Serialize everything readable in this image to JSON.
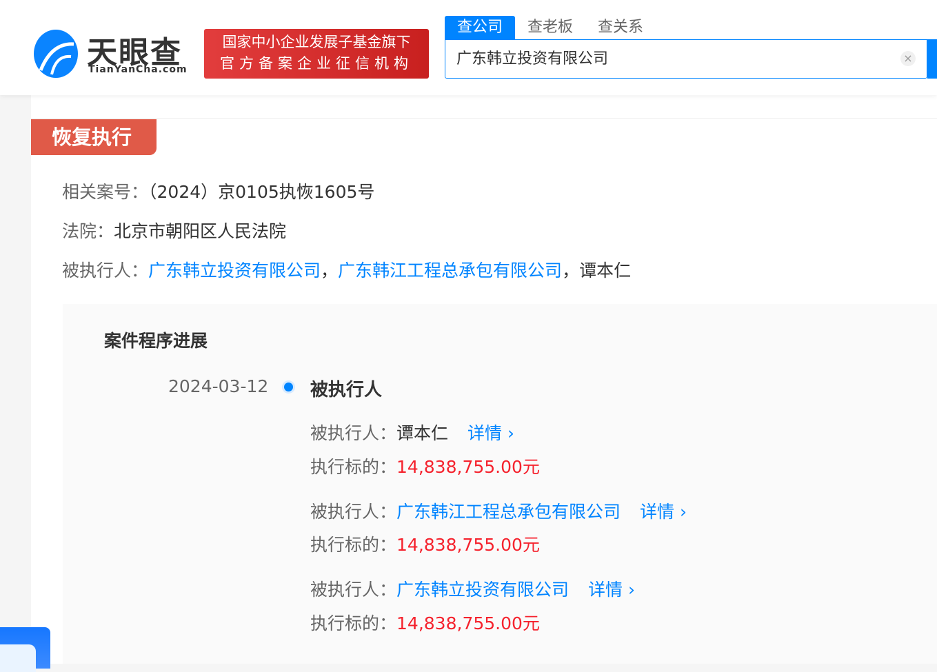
{
  "header": {
    "logo_text": "天眼查",
    "logo_sub": "TianYanCha.com",
    "badge_line1": "国家中小企业发展子基金旗下",
    "badge_line2": "官方备案企业征信机构",
    "tabs": [
      {
        "label": "查公司",
        "active": true
      },
      {
        "label": "查老板"
      },
      {
        "label": "查关系"
      }
    ],
    "search_value": "广东韩立投资有限公司",
    "clear_icon": "×"
  },
  "section": {
    "tag": "恢复执行",
    "case_label": "相关案号：",
    "case_value": "（2024）京0105执恢1605号",
    "court_label": "法院：",
    "court_value": "北京市朝阳区人民法院",
    "party_label": "被执行人：",
    "parties": [
      "广东韩立投资有限公司",
      "广东韩江工程总承包有限公司",
      "谭本仁"
    ],
    "sep": "，"
  },
  "progress": {
    "title": "案件程序进展",
    "date": "2024-03-12",
    "event": "被执行人",
    "items": [
      {
        "party_label": "被执行人：",
        "party": "谭本仁",
        "detail": "详情 ›",
        "amount_label": "执行标的：",
        "amount": "14,838,755.00元"
      },
      {
        "party_label": "被执行人：",
        "party": "广东韩江工程总承包有限公司",
        "detail": "详情 ›",
        "amount_label": "执行标的：",
        "amount": "14,838,755.00元"
      },
      {
        "party_label": "被执行人：",
        "party": "广东韩立投资有限公司",
        "detail": "详情 ›",
        "amount_label": "执行标的：",
        "amount": "14,838,755.00元"
      }
    ]
  },
  "colors": {
    "brand": "#0084ff",
    "tag": "#e05a48",
    "amount": "#f5222d"
  }
}
